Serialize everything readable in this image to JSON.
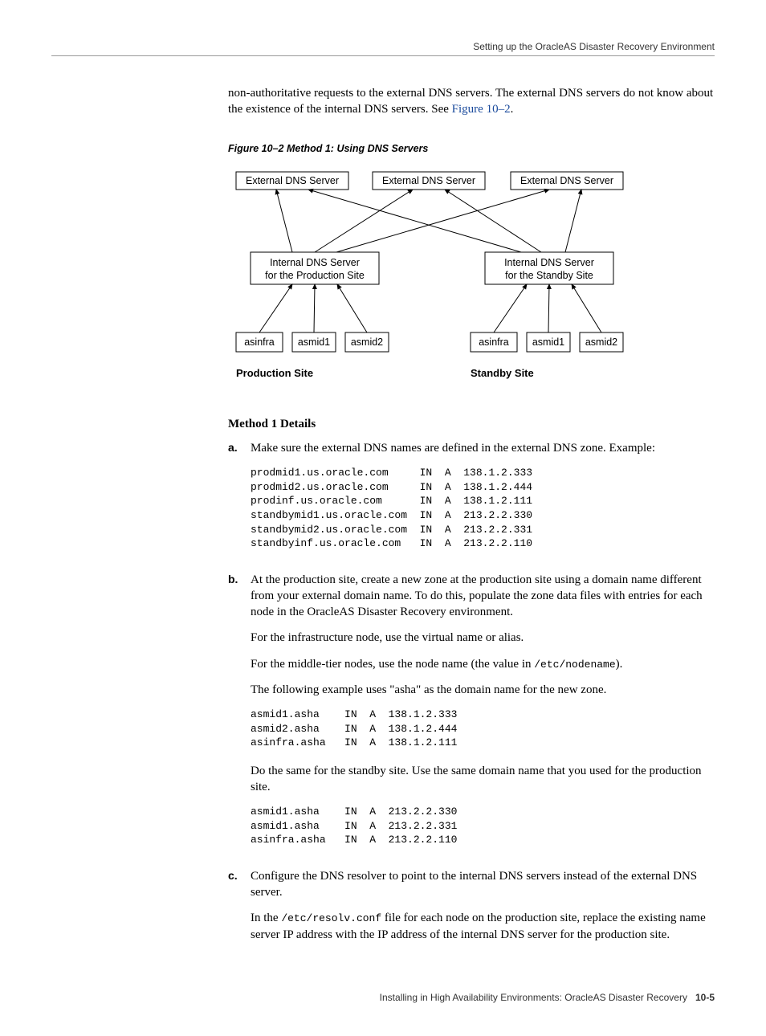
{
  "header": {
    "running_title": "Setting up the OracleAS Disaster Recovery Environment"
  },
  "intro": {
    "text_before_link": "non-authoritative requests to the external DNS servers. The external DNS servers do not know about the existence of the internal DNS servers. See ",
    "link_text": "Figure 10–2",
    "text_after_link": "."
  },
  "figure": {
    "caption": "Figure 10–2    Method 1: Using DNS Servers",
    "ext_dns": "External DNS Server",
    "int_dns_prod_l1": "Internal DNS Server",
    "int_dns_prod_l2": "for the Production Site",
    "int_dns_stby_l1": "Internal DNS Server",
    "int_dns_stby_l2": "for the Standby Site",
    "nodes": [
      "asinfra",
      "asmid1",
      "asmid2"
    ],
    "prod_label": "Production Site",
    "stby_label": "Standby Site"
  },
  "method_heading": "Method 1 Details",
  "steps": {
    "a": {
      "marker": "a.",
      "p1": "Make sure the external DNS names are defined in the external DNS zone. Example:",
      "code": "prodmid1.us.oracle.com     IN  A  138.1.2.333\nprodmid2.us.oracle.com     IN  A  138.1.2.444\nprodinf.us.oracle.com      IN  A  138.1.2.111\nstandbymid1.us.oracle.com  IN  A  213.2.2.330\nstandbymid2.us.oracle.com  IN  A  213.2.2.331\nstandbyinf.us.oracle.com   IN  A  213.2.2.110"
    },
    "b": {
      "marker": "b.",
      "p1": "At the production site, create a new zone at the production site using a domain name different from your external domain name. To do this, populate the zone data files with entries for each node in the OracleAS Disaster Recovery environment.",
      "p2": "For the infrastructure node, use the virtual name or alias.",
      "p3_before": "For the middle-tier nodes, use the node name (the value in ",
      "p3_code": "/etc/nodename",
      "p3_after": ").",
      "p4": "The following example uses \"asha\" as the domain name for the new zone.",
      "code1": "asmid1.asha    IN  A  138.1.2.333\nasmid2.asha    IN  A  138.1.2.444\nasinfra.asha   IN  A  138.1.2.111",
      "p5": "Do the same for the standby site. Use the same domain name that you used for the production site.",
      "code2": "asmid1.asha    IN  A  213.2.2.330\nasmid1.asha    IN  A  213.2.2.331\nasinfra.asha   IN  A  213.2.2.110"
    },
    "c": {
      "marker": "c.",
      "p1": "Configure the DNS resolver to point to the internal DNS servers instead of the external DNS server.",
      "p2_before": "In the ",
      "p2_code": "/etc/resolv.conf",
      "p2_after": " file for each node on the production site, replace the existing name server IP address with the IP address of the internal DNS server for the production site."
    }
  },
  "footer": {
    "text": "Installing in High Availability Environments: OracleAS Disaster Recovery",
    "page": "10-5"
  }
}
